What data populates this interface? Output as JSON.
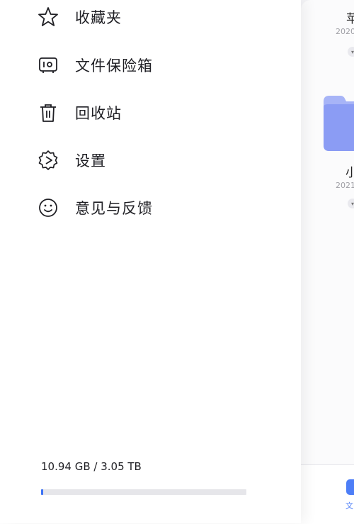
{
  "drawer": {
    "menu": [
      {
        "label": "收藏夹",
        "icon": "star-icon"
      },
      {
        "label": "文件保险箱",
        "icon": "safe-box-icon"
      },
      {
        "label": "回收站",
        "icon": "trash-icon"
      },
      {
        "label": "设置",
        "icon": "settings-gear-icon"
      },
      {
        "label": "意见与反馈",
        "icon": "smiley-feedback-icon"
      }
    ],
    "storage": {
      "text": "10.94 GB / 3.05 TB",
      "used_fraction": 0.0035
    }
  },
  "background": {
    "files": [
      {
        "name_partial": "苹",
        "date_partial": "2020"
      },
      {
        "name_partial": "小",
        "date_partial": "2021"
      }
    ],
    "tab": {
      "label_partial": "文"
    },
    "colors": {
      "accent": "#4d7ef7",
      "folder": "#8b9cf4"
    }
  }
}
